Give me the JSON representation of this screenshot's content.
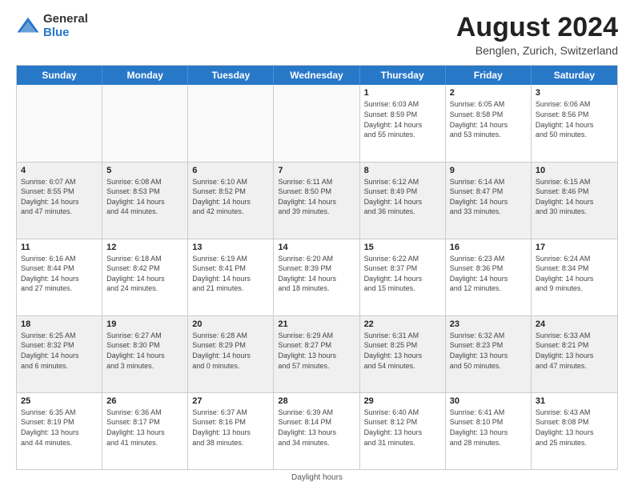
{
  "logo": {
    "general": "General",
    "blue": "Blue"
  },
  "title": "August 2024",
  "subtitle": "Benglen, Zurich, Switzerland",
  "days_of_week": [
    "Sunday",
    "Monday",
    "Tuesday",
    "Wednesday",
    "Thursday",
    "Friday",
    "Saturday"
  ],
  "footer": "Daylight hours",
  "weeks": [
    [
      {
        "day": "",
        "info": "",
        "empty": true
      },
      {
        "day": "",
        "info": "",
        "empty": true
      },
      {
        "day": "",
        "info": "",
        "empty": true
      },
      {
        "day": "",
        "info": "",
        "empty": true
      },
      {
        "day": "1",
        "info": "Sunrise: 6:03 AM\nSunset: 8:59 PM\nDaylight: 14 hours\nand 55 minutes."
      },
      {
        "day": "2",
        "info": "Sunrise: 6:05 AM\nSunset: 8:58 PM\nDaylight: 14 hours\nand 53 minutes."
      },
      {
        "day": "3",
        "info": "Sunrise: 6:06 AM\nSunset: 8:56 PM\nDaylight: 14 hours\nand 50 minutes."
      }
    ],
    [
      {
        "day": "4",
        "info": "Sunrise: 6:07 AM\nSunset: 8:55 PM\nDaylight: 14 hours\nand 47 minutes."
      },
      {
        "day": "5",
        "info": "Sunrise: 6:08 AM\nSunset: 8:53 PM\nDaylight: 14 hours\nand 44 minutes."
      },
      {
        "day": "6",
        "info": "Sunrise: 6:10 AM\nSunset: 8:52 PM\nDaylight: 14 hours\nand 42 minutes."
      },
      {
        "day": "7",
        "info": "Sunrise: 6:11 AM\nSunset: 8:50 PM\nDaylight: 14 hours\nand 39 minutes."
      },
      {
        "day": "8",
        "info": "Sunrise: 6:12 AM\nSunset: 8:49 PM\nDaylight: 14 hours\nand 36 minutes."
      },
      {
        "day": "9",
        "info": "Sunrise: 6:14 AM\nSunset: 8:47 PM\nDaylight: 14 hours\nand 33 minutes."
      },
      {
        "day": "10",
        "info": "Sunrise: 6:15 AM\nSunset: 8:46 PM\nDaylight: 14 hours\nand 30 minutes."
      }
    ],
    [
      {
        "day": "11",
        "info": "Sunrise: 6:16 AM\nSunset: 8:44 PM\nDaylight: 14 hours\nand 27 minutes."
      },
      {
        "day": "12",
        "info": "Sunrise: 6:18 AM\nSunset: 8:42 PM\nDaylight: 14 hours\nand 24 minutes."
      },
      {
        "day": "13",
        "info": "Sunrise: 6:19 AM\nSunset: 8:41 PM\nDaylight: 14 hours\nand 21 minutes."
      },
      {
        "day": "14",
        "info": "Sunrise: 6:20 AM\nSunset: 8:39 PM\nDaylight: 14 hours\nand 18 minutes."
      },
      {
        "day": "15",
        "info": "Sunrise: 6:22 AM\nSunset: 8:37 PM\nDaylight: 14 hours\nand 15 minutes."
      },
      {
        "day": "16",
        "info": "Sunrise: 6:23 AM\nSunset: 8:36 PM\nDaylight: 14 hours\nand 12 minutes."
      },
      {
        "day": "17",
        "info": "Sunrise: 6:24 AM\nSunset: 8:34 PM\nDaylight: 14 hours\nand 9 minutes."
      }
    ],
    [
      {
        "day": "18",
        "info": "Sunrise: 6:25 AM\nSunset: 8:32 PM\nDaylight: 14 hours\nand 6 minutes."
      },
      {
        "day": "19",
        "info": "Sunrise: 6:27 AM\nSunset: 8:30 PM\nDaylight: 14 hours\nand 3 minutes."
      },
      {
        "day": "20",
        "info": "Sunrise: 6:28 AM\nSunset: 8:29 PM\nDaylight: 14 hours\nand 0 minutes."
      },
      {
        "day": "21",
        "info": "Sunrise: 6:29 AM\nSunset: 8:27 PM\nDaylight: 13 hours\nand 57 minutes."
      },
      {
        "day": "22",
        "info": "Sunrise: 6:31 AM\nSunset: 8:25 PM\nDaylight: 13 hours\nand 54 minutes."
      },
      {
        "day": "23",
        "info": "Sunrise: 6:32 AM\nSunset: 8:23 PM\nDaylight: 13 hours\nand 50 minutes."
      },
      {
        "day": "24",
        "info": "Sunrise: 6:33 AM\nSunset: 8:21 PM\nDaylight: 13 hours\nand 47 minutes."
      }
    ],
    [
      {
        "day": "25",
        "info": "Sunrise: 6:35 AM\nSunset: 8:19 PM\nDaylight: 13 hours\nand 44 minutes."
      },
      {
        "day": "26",
        "info": "Sunrise: 6:36 AM\nSunset: 8:17 PM\nDaylight: 13 hours\nand 41 minutes."
      },
      {
        "day": "27",
        "info": "Sunrise: 6:37 AM\nSunset: 8:16 PM\nDaylight: 13 hours\nand 38 minutes."
      },
      {
        "day": "28",
        "info": "Sunrise: 6:39 AM\nSunset: 8:14 PM\nDaylight: 13 hours\nand 34 minutes."
      },
      {
        "day": "29",
        "info": "Sunrise: 6:40 AM\nSunset: 8:12 PM\nDaylight: 13 hours\nand 31 minutes."
      },
      {
        "day": "30",
        "info": "Sunrise: 6:41 AM\nSunset: 8:10 PM\nDaylight: 13 hours\nand 28 minutes."
      },
      {
        "day": "31",
        "info": "Sunrise: 6:43 AM\nSunset: 8:08 PM\nDaylight: 13 hours\nand 25 minutes."
      }
    ]
  ]
}
